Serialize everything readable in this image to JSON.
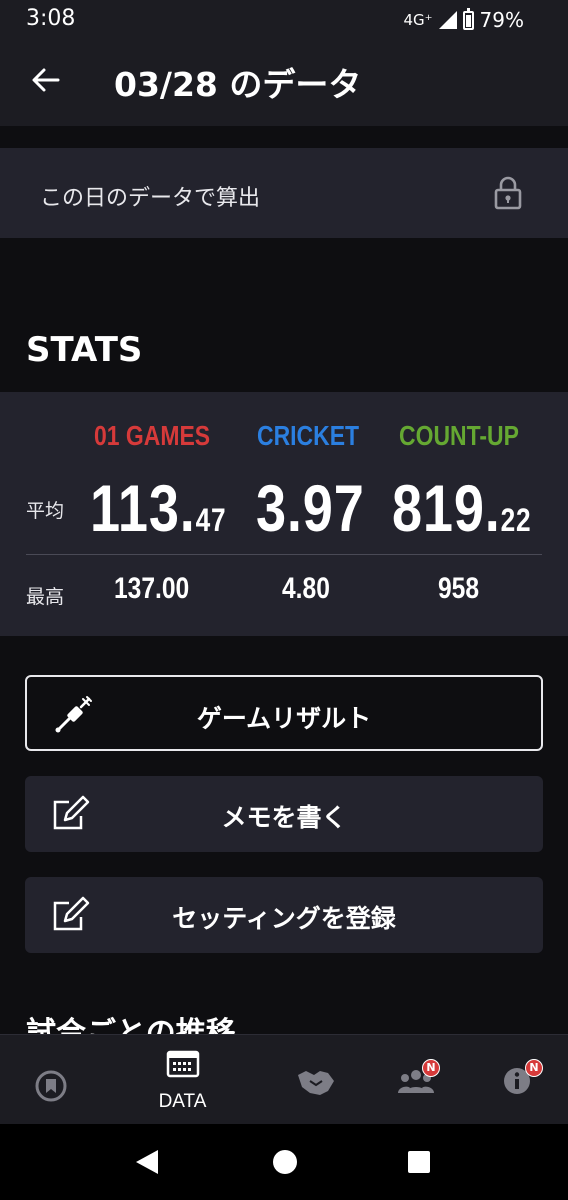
{
  "status_bar": {
    "time": "3:08",
    "network": "4G⁺",
    "battery": "79%"
  },
  "header": {
    "title": "03/28 のデータ"
  },
  "calc_option": {
    "label": "この日のデータで算出"
  },
  "stats": {
    "heading": "STATS",
    "columns": [
      {
        "name": "01 GAMES",
        "avg_int": "113.",
        "avg_dec": "47",
        "max": "137.00",
        "color": "#d63a3a"
      },
      {
        "name": "CRICKET",
        "avg_int": "3.97",
        "avg_dec": "",
        "max": "4.80",
        "color": "#2b7fe0"
      },
      {
        "name": "COUNT-UP",
        "avg_int": "819.",
        "avg_dec": "22",
        "max": "958",
        "color": "#65a832"
      }
    ],
    "avg_label": "平均",
    "max_label": "最高"
  },
  "actions": {
    "game_result": "ゲームリザルト",
    "write_memo": "メモを書く",
    "register_setting": "セッティングを登録"
  },
  "section_peek": "試合ごとの推移",
  "tabs": [
    {
      "icon": "home-badge-icon"
    },
    {
      "icon": "calendar-icon",
      "label": "DATA"
    },
    {
      "icon": "handshake-icon"
    },
    {
      "icon": "friends-icon",
      "badge": "N"
    },
    {
      "icon": "info-icon",
      "badge": "N"
    }
  ]
}
